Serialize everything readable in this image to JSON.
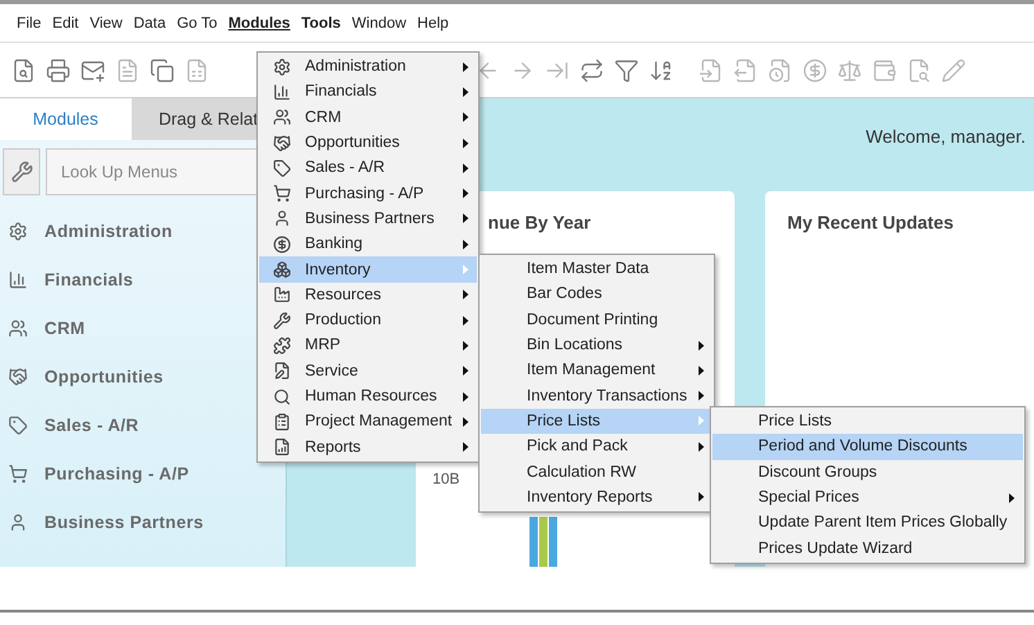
{
  "menu_bar": [
    {
      "label": "File",
      "selected": false,
      "bold": false
    },
    {
      "label": "Edit",
      "selected": false,
      "bold": false
    },
    {
      "label": "View",
      "selected": false,
      "bold": false
    },
    {
      "label": "Data",
      "selected": false,
      "bold": false
    },
    {
      "label": "Go To",
      "selected": false,
      "bold": false
    },
    {
      "label": "Modules",
      "selected": true,
      "bold": true
    },
    {
      "label": "Tools",
      "selected": false,
      "bold": true
    },
    {
      "label": "Window",
      "selected": false,
      "bold": false
    },
    {
      "label": "Help",
      "selected": false,
      "bold": false
    }
  ],
  "tabs": [
    {
      "label": "Modules",
      "selected": true
    },
    {
      "label": "Drag & Relat",
      "selected": false
    }
  ],
  "lookup": {
    "placeholder": "Look Up Menus"
  },
  "sidebar": {
    "items": [
      {
        "label": "Administration"
      },
      {
        "label": "Financials"
      },
      {
        "label": "CRM"
      },
      {
        "label": "Opportunities"
      },
      {
        "label": "Sales - A/R"
      },
      {
        "label": "Purchasing - A/P"
      },
      {
        "label": "Business Partners"
      }
    ]
  },
  "welcome": "Welcome, manager.",
  "cards": [
    {
      "title": "nue By Year",
      "axis_label": "10B"
    },
    {
      "title": "My Recent Updates"
    }
  ],
  "modules_menu": [
    {
      "label": "Administration",
      "submenu": true,
      "selected": false
    },
    {
      "label": "Financials",
      "submenu": true,
      "selected": false
    },
    {
      "label": "CRM",
      "submenu": true,
      "selected": false
    },
    {
      "label": "Opportunities",
      "submenu": true,
      "selected": false
    },
    {
      "label": "Sales - A/R",
      "submenu": true,
      "selected": false
    },
    {
      "label": "Purchasing - A/P",
      "submenu": true,
      "selected": false
    },
    {
      "label": "Business Partners",
      "submenu": true,
      "selected": false
    },
    {
      "label": "Banking",
      "submenu": true,
      "selected": false
    },
    {
      "label": "Inventory",
      "submenu": true,
      "selected": true
    },
    {
      "label": "Resources",
      "submenu": true,
      "selected": false
    },
    {
      "label": "Production",
      "submenu": true,
      "selected": false
    },
    {
      "label": "MRP",
      "submenu": true,
      "selected": false
    },
    {
      "label": "Service",
      "submenu": true,
      "selected": false
    },
    {
      "label": "Human Resources",
      "submenu": true,
      "selected": false
    },
    {
      "label": "Project Management",
      "submenu": true,
      "selected": false
    },
    {
      "label": "Reports",
      "submenu": true,
      "selected": false
    }
  ],
  "inventory_menu": [
    {
      "label": "Item Master Data",
      "submenu": false,
      "selected": false
    },
    {
      "label": "Bar Codes",
      "submenu": false,
      "selected": false
    },
    {
      "label": "Document Printing",
      "submenu": false,
      "selected": false
    },
    {
      "label": "Bin Locations",
      "submenu": true,
      "selected": false
    },
    {
      "label": "Item Management",
      "submenu": true,
      "selected": false
    },
    {
      "label": "Inventory Transactions",
      "submenu": true,
      "selected": false
    },
    {
      "label": "Price Lists",
      "submenu": true,
      "selected": true
    },
    {
      "label": "Pick and Pack",
      "submenu": true,
      "selected": false
    },
    {
      "label": "Calculation RW",
      "submenu": false,
      "selected": false
    },
    {
      "label": "Inventory Reports",
      "submenu": true,
      "selected": false
    }
  ],
  "price_lists_menu": [
    {
      "label": "Price Lists",
      "submenu": false,
      "selected": false
    },
    {
      "label": "Period and Volume Discounts",
      "submenu": false,
      "selected": true
    },
    {
      "label": "Discount Groups",
      "submenu": false,
      "selected": false
    },
    {
      "label": "Special Prices",
      "submenu": true,
      "selected": false
    },
    {
      "label": "Update Parent Item Prices Globally",
      "submenu": false,
      "selected": false
    },
    {
      "label": "Prices Update Wizard",
      "submenu": false,
      "selected": false
    }
  ]
}
